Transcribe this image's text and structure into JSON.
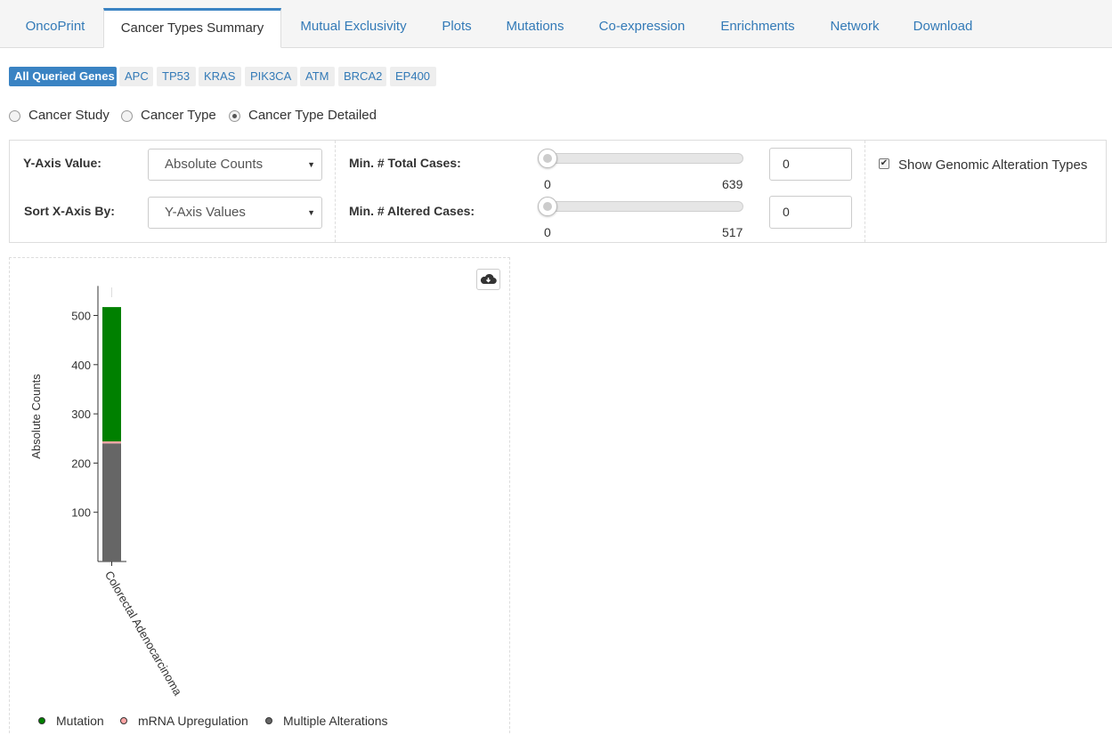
{
  "tabs": [
    {
      "label": "OncoPrint",
      "active": false
    },
    {
      "label": "Cancer Types Summary",
      "active": true
    },
    {
      "label": "Mutual Exclusivity",
      "active": false
    },
    {
      "label": "Plots",
      "active": false
    },
    {
      "label": "Mutations",
      "active": false
    },
    {
      "label": "Co-expression",
      "active": false
    },
    {
      "label": "Enrichments",
      "active": false
    },
    {
      "label": "Network",
      "active": false
    },
    {
      "label": "Download",
      "active": false
    }
  ],
  "genes": [
    "All Queried Genes",
    "APC",
    "TP53",
    "KRAS",
    "PIK3CA",
    "ATM",
    "BRCA2",
    "EP400"
  ],
  "grouping": {
    "options": [
      "Cancer Study",
      "Cancer Type",
      "Cancer Type Detailed"
    ],
    "selected": "Cancer Type Detailed"
  },
  "controls": {
    "y_axis_label": "Y-Axis Value:",
    "y_axis_value": "Absolute Counts",
    "sort_label": "Sort X-Axis By:",
    "sort_value": "Y-Axis Values",
    "total_cases_label": "Min. # Total Cases:",
    "total_cases_min": "0",
    "total_cases_max": "639",
    "total_cases_input": "0",
    "altered_cases_label": "Min. # Altered Cases:",
    "altered_cases_min": "0",
    "altered_cases_max": "517",
    "altered_cases_input": "0",
    "show_alterations_label": "Show Genomic Alteration Types",
    "show_alterations_checked": true
  },
  "icons": {
    "download": "cloud-download-icon",
    "checkbox": "checkmark-icon",
    "select_caret": "caret-down-icon"
  },
  "chart_data": {
    "type": "bar",
    "stacked": true,
    "ylabel": "Absolute Counts",
    "ylim": [
      0,
      560
    ],
    "yticks": [
      100,
      200,
      300,
      400,
      500
    ],
    "categories": [
      "Colorectal Adenocarcinoma"
    ],
    "series": [
      {
        "name": "Multiple Alterations",
        "color": "#666666",
        "values": [
          240
        ]
      },
      {
        "name": "mRNA Upregulation",
        "color": "#FFA5A5",
        "values": [
          4
        ]
      },
      {
        "name": "Mutation",
        "color": "#008000",
        "values": [
          273
        ]
      }
    ],
    "legend": [
      "Mutation",
      "mRNA Upregulation",
      "Multiple Alterations"
    ],
    "legend_position": "bottom"
  }
}
